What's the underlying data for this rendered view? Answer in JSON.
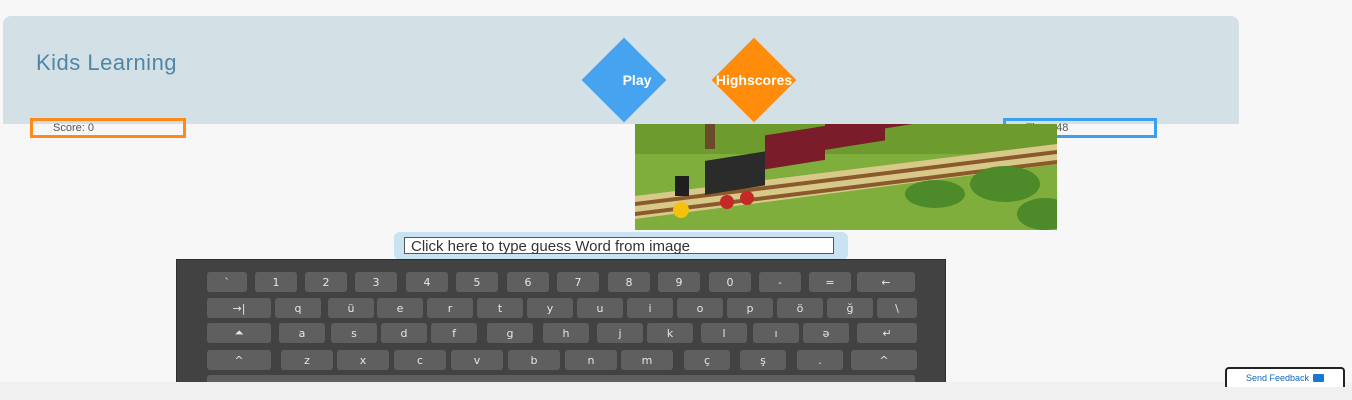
{
  "header": {
    "title": "Kids Learning",
    "play_label": "Play",
    "highscores_label": "Highscores",
    "score_text": "Score: 0",
    "time_text": "Time: 48"
  },
  "guess": {
    "value": "Click here to type guess Word from image"
  },
  "keyboard": {
    "rows": [
      [
        "`",
        "1",
        "2",
        "3",
        "4",
        "5",
        "6",
        "7",
        "8",
        "9",
        "0",
        "-",
        "=",
        "←"
      ],
      [
        "→|",
        "q",
        "ü",
        "e",
        "r",
        "t",
        "y",
        "u",
        "i",
        "o",
        "p",
        "ö",
        "ğ",
        "\\"
      ],
      [
        "⏶",
        "a",
        "s",
        "d",
        "f",
        "g",
        "h",
        "j",
        "k",
        "l",
        "ı",
        "ə",
        "↵"
      ],
      [
        "^",
        "z",
        "x",
        "c",
        "v",
        "b",
        "n",
        "m",
        "ç",
        "ş",
        ".",
        "^"
      ],
      [
        ""
      ]
    ]
  },
  "footer": {
    "feedback_label": "Send Feedback"
  },
  "colors": {
    "header_bg": "#d3e1e7",
    "play": "#45a3f0",
    "highscores": "#ff8c0a",
    "score_border": "#ff8a1c",
    "time_border": "#3aa0f0",
    "keyboard_bg": "#424242"
  }
}
